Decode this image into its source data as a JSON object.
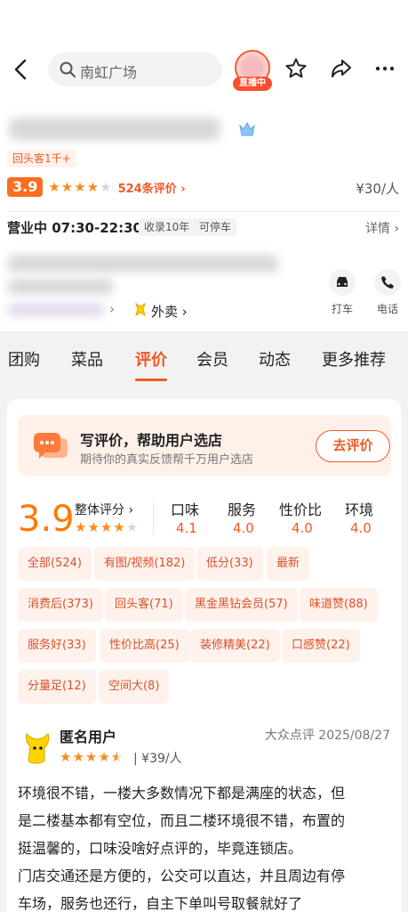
{
  "header": {
    "search_placeholder": "南虹广场",
    "live_tag": "直播中"
  },
  "shop": {
    "returning_tag": "回头客1千+",
    "score": "3.9",
    "review_count": "524条评价 ›",
    "price": "¥30/人",
    "hours": "营业中 07:30-22:30",
    "chips": [
      "收录10年",
      "可停车"
    ],
    "detail_link": "详情 ›",
    "address_arrow": "›",
    "takeout": "外卖 ›",
    "actions": [
      {
        "label": "打车",
        "icon": "car-icon"
      },
      {
        "label": "电话",
        "icon": "phone-icon"
      }
    ]
  },
  "tabs": [
    "团购",
    "菜品",
    "评价",
    "会员",
    "动态",
    "更多推荐"
  ],
  "active_tab": "评价",
  "review_promo": {
    "title": "写评价，帮助用户选店",
    "subtitle": "期待你的真实反馈帮千万用户选店",
    "button": "去评价"
  },
  "scores": {
    "overall_score": "3.9",
    "overall_label": "整体评分 ›",
    "items": [
      {
        "label": "口味",
        "value": "4.1"
      },
      {
        "label": "服务",
        "value": "4.0"
      },
      {
        "label": "性价比",
        "value": "4.0"
      },
      {
        "label": "环境",
        "value": "4.0"
      }
    ]
  },
  "filters": [
    "全部(524)",
    "有图/视频(182)",
    "低分(33)",
    "最新",
    "消费后(373)",
    "回头客(71)",
    "黑金黑钻会员(57)",
    "味道赞(88)",
    "服务好(33)",
    "性价比高(25)",
    "装修精美(22)",
    "口感赞(22)",
    "分量足(12)",
    "空间大(8)"
  ],
  "review": {
    "user": "匿名用户",
    "stars": 4.5,
    "price": "| ¥39/人",
    "source_date": "大众点评  2025/08/27",
    "lines": [
      "环境很不错，一楼大多数情况下都是满座的状态，但",
      "是二楼基本都有空位，而且二楼环境很不错，布置的",
      "挺温馨的，口味没啥好点评的，毕竟连锁店。",
      "门店交通还是方便的，公交可以直达，并且周边有停",
      "车场，服务也还行，自主下单叫号取餐就好了"
    ]
  },
  "colors": {
    "accent": "#f05a24",
    "star": "#ff8a1a",
    "score": "#ff7a00"
  }
}
